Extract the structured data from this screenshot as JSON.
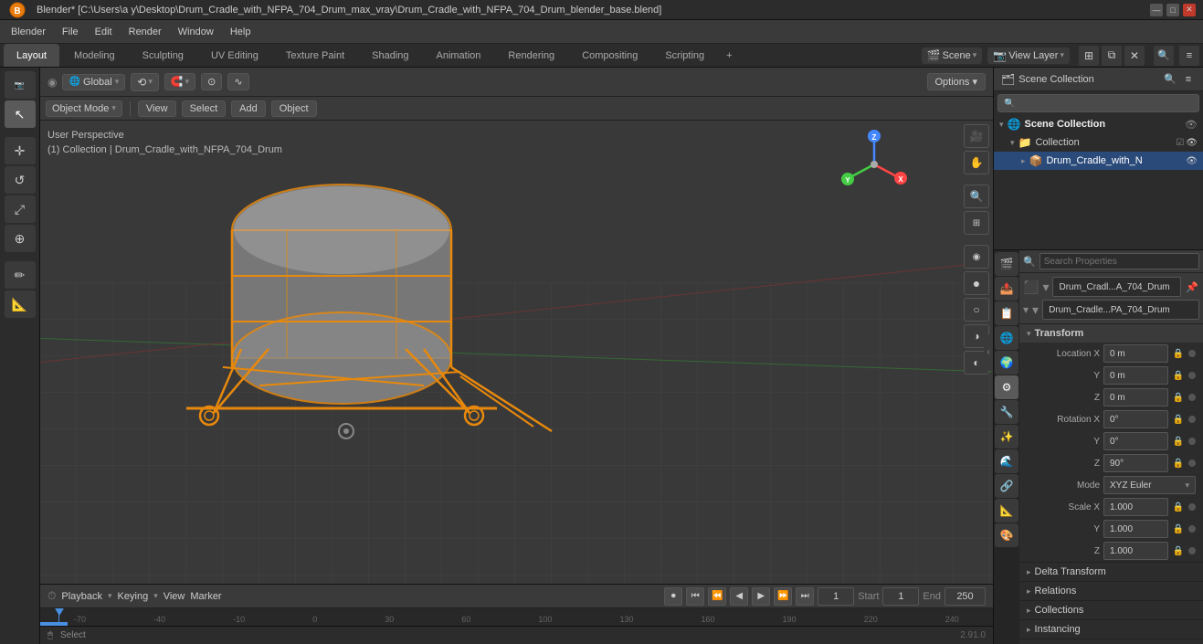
{
  "titlebar": {
    "title": "Blender* [C:\\Users\\a y\\Desktop\\Drum_Cradle_with_NFPA_704_Drum_max_vray\\Drum_Cradle_with_NFPA_704_Drum_blender_base.blend]",
    "controls": [
      "—",
      "□",
      "✕"
    ]
  },
  "menubar": {
    "items": [
      "Blender",
      "File",
      "Edit",
      "Render",
      "Window",
      "Help"
    ]
  },
  "workspace_tabs": {
    "tabs": [
      "Layout",
      "Modeling",
      "Sculpting",
      "UV Editing",
      "Texture Paint",
      "Shading",
      "Animation",
      "Rendering",
      "Compositing",
      "Scripting"
    ],
    "active": "Layout",
    "add_icon": "+",
    "scene": "Scene",
    "view_layer": "View Layer"
  },
  "viewport_header": {
    "mode": "Object Mode",
    "menu_items": [
      "View",
      "Select",
      "Add",
      "Object"
    ]
  },
  "top_bar": {
    "transform": "Global",
    "icons": [
      "⟳",
      "⟲",
      "⊕",
      "≡",
      "∿"
    ],
    "options": "Options ▾"
  },
  "viewport": {
    "info_line1": "User Perspective",
    "info_line2": "(1) Collection | Drum_Cradle_with_NFPA_704_Drum"
  },
  "outliner": {
    "header": "Scene Collection",
    "search_placeholder": "🔍",
    "items": [
      {
        "label": "Collection",
        "icon": "📁",
        "indent": 0,
        "expanded": true,
        "visible": true,
        "camera": true
      },
      {
        "label": "Drum_Cradle_with_N",
        "icon": "📦",
        "indent": 1,
        "selected": true,
        "visible": true
      }
    ]
  },
  "properties": {
    "active_object": "Drum_Cradl...A_704_Drum",
    "active_mesh": "Drum_Cradle...PA_704_Drum",
    "section": "Transform",
    "location": {
      "x": "0 m",
      "y": "0 m",
      "z": "0 m"
    },
    "rotation": {
      "x": "0°",
      "y": "0°",
      "z": "90°"
    },
    "rotation_mode": "XYZ Euler",
    "scale": {
      "x": "1.000",
      "y": "1.000",
      "z": "1.000"
    },
    "subsections": [
      "Delta Transform",
      "Relations",
      "Collections",
      "Instancing"
    ]
  },
  "timeline": {
    "current_frame": "1",
    "start_frame": "1",
    "end_frame": "250",
    "playback_label": "Playback",
    "keying_label": "Keying",
    "view_label": "View",
    "marker_label": "Marker"
  },
  "statusbar": {
    "select_label": "Select",
    "version": "2.91.0"
  },
  "props_tabs": [
    "🎬",
    "🌐",
    "⚙",
    "✏",
    "📐",
    "🔲",
    "💡",
    "📷",
    "🌊",
    "🔧",
    "🎨",
    "🔗"
  ]
}
